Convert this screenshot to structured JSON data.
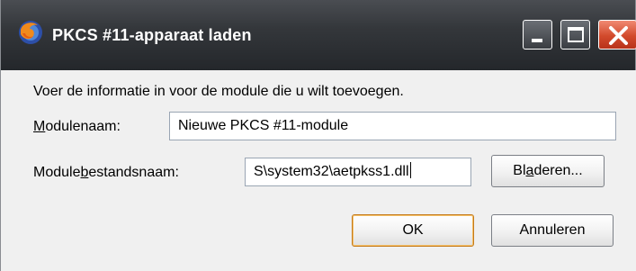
{
  "window": {
    "title": "PKCS #11-apparaat laden",
    "app_icon": "firefox-icon",
    "controls": [
      "minimize-icon",
      "maximize-icon",
      "close-icon"
    ]
  },
  "form": {
    "instruction": "Voer de informatie in voor de module die u wilt toevoegen.",
    "module_name": {
      "label_pre": "",
      "label_accel": "M",
      "label_post": "odulenaam:",
      "value": "Nieuwe PKCS #11-module"
    },
    "module_file": {
      "label_pre": "Module",
      "label_accel": "b",
      "label_post": "estandsnaam:",
      "value": "S\\system32\\aetpkss1.dll"
    },
    "browse": {
      "pre": "Bl",
      "accel": "a",
      "post": "deren..."
    }
  },
  "buttons": {
    "ok": "OK",
    "cancel": "Annuleren"
  },
  "colors": {
    "titlebar": "#34373b",
    "close_button": "#d24a2c",
    "default_button_border": "#c47a1b"
  }
}
